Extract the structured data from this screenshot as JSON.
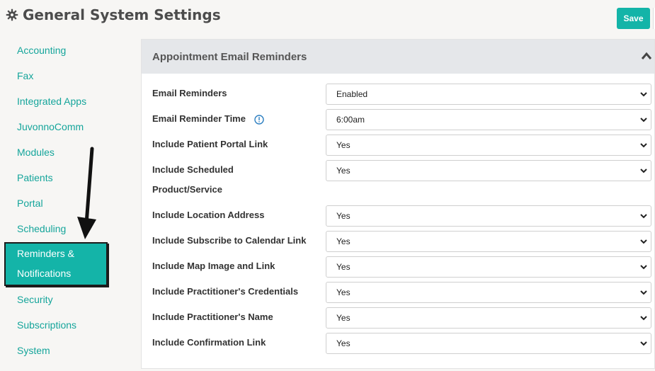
{
  "header": {
    "title": "General System Settings",
    "save_label": "Save"
  },
  "sidebar": {
    "items": [
      {
        "label": "Accounting"
      },
      {
        "label": "Fax"
      },
      {
        "label": "Integrated Apps"
      },
      {
        "label": "JuvonnoComm"
      },
      {
        "label": "Modules"
      },
      {
        "label": "Patients"
      },
      {
        "label": "Portal"
      },
      {
        "label": "Scheduling"
      },
      {
        "label": "Reminders &"
      },
      {
        "label": "Security"
      },
      {
        "label": "Subscriptions"
      },
      {
        "label": "System"
      }
    ],
    "active_line2": "Notifications"
  },
  "panel": {
    "title": "Appointment Email Reminders",
    "rows": [
      {
        "label": "Email Reminders",
        "value": "Enabled"
      },
      {
        "label": "Email Reminder Time",
        "value": "6:00am"
      },
      {
        "label": "Include Patient Portal Link",
        "value": "Yes"
      },
      {
        "label": "Include Scheduled",
        "label_line2": "Product/Service",
        "value": "Yes"
      },
      {
        "label": "Include Location Address",
        "value": "Yes"
      },
      {
        "label": "Include Subscribe to Calendar Link",
        "value": "Yes"
      },
      {
        "label": "Include Map Image and Link",
        "value": "Yes"
      },
      {
        "label": "Include Practitioner's Credentials",
        "value": "Yes"
      },
      {
        "label": "Include Practitioner's Name",
        "value": "Yes"
      },
      {
        "label": "Include Confirmation Link",
        "value": "Yes"
      }
    ]
  },
  "colors": {
    "accent": "#14b4a8",
    "link": "#15a59b",
    "panel_header": "#e5e7ea",
    "page_bg": "#f7f6f4"
  },
  "icons": {
    "title_icon": "gear-icon",
    "info_icon": "info-icon",
    "collapse_icon": "chevron-up-icon",
    "select_icon": "chevron-down-icon",
    "annotation": "arrow-annotation"
  }
}
